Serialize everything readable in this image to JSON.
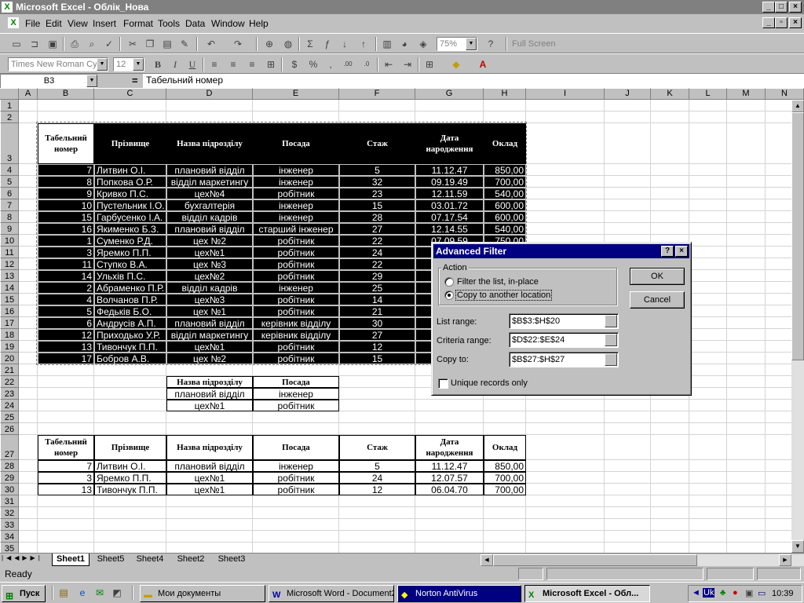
{
  "window": {
    "title": "Microsoft Excel - Облік_Нова"
  },
  "menu": [
    "File",
    "Edit",
    "View",
    "Insert",
    "Format",
    "Tools",
    "Data",
    "Window",
    "Help"
  ],
  "toolbar": {
    "zoom": "75%",
    "fullscreen": "Full Screen",
    "font_name": "Times New Roman Cyr",
    "font_size": "12"
  },
  "formula": {
    "name_box": "B3",
    "eq": "=",
    "content": "Табельний  номер"
  },
  "columns": [
    "A",
    "B",
    "C",
    "D",
    "E",
    "F",
    "G",
    "H",
    "I",
    "J",
    "K",
    "L",
    "M",
    "N"
  ],
  "rows": [
    "1",
    "2",
    "3",
    "4",
    "5",
    "6",
    "7",
    "8",
    "9",
    "10",
    "11",
    "12",
    "13",
    "14",
    "15",
    "16",
    "17",
    "18",
    "19",
    "20",
    "21",
    "22",
    "23",
    "24",
    "25",
    "26",
    "27",
    "28",
    "29",
    "30",
    "31",
    "32",
    "33",
    "34",
    "35"
  ],
  "table_headers": [
    "Табельний номер",
    "Прізвище",
    "Назва підрозділу",
    "Посада",
    "Стаж",
    "Дата народження",
    "Оклад"
  ],
  "main_rows": [
    [
      "7",
      "Литвин О.І.",
      "плановий відділ",
      "інженер",
      "5",
      "11.12.47",
      "850,00"
    ],
    [
      "8",
      "Попкова О.Р.",
      "відділ маркетингу",
      "інженер",
      "32",
      "09.19.49",
      "700,00"
    ],
    [
      "9",
      "Кривко П.С.",
      "цех№4",
      "робітник",
      "23",
      "12.11.59",
      "540,00"
    ],
    [
      "10",
      "Пустельник І.О.",
      "бухгалтерія",
      "інженер",
      "15",
      "03.01.72",
      "600,00"
    ],
    [
      "15",
      "Гарбусенко І.А.",
      "відділ кадрів",
      "інженер",
      "28",
      "07.17.54",
      "600,00"
    ],
    [
      "16",
      "Якименко Б.З.",
      "плановий відділ",
      "старший інженер",
      "27",
      "12.14.55",
      "540,00"
    ],
    [
      "1",
      "Суменко Р.Д.",
      "цех №2",
      "робітник",
      "22",
      "07.09.59",
      "750,00"
    ],
    [
      "3",
      "Яремко П.П.",
      "цех№1",
      "робітник",
      "24",
      "",
      "",
      ""
    ],
    [
      "11",
      "Ступко В.А.",
      "цех №3",
      "робітник",
      "22",
      "",
      ""
    ],
    [
      "14",
      "Ульхів П.С.",
      "цех№2",
      "робітник",
      "29",
      "",
      ""
    ],
    [
      "2",
      "Абраменко П.Р.",
      "відділ кадрів",
      "інженер",
      "25",
      "",
      ""
    ],
    [
      "4",
      "Волчанов П.Р.",
      "цех№3",
      "робітник",
      "14",
      "",
      ""
    ],
    [
      "5",
      "Федьків Б.О.",
      "цех №1",
      "робітник",
      "21",
      "",
      ""
    ],
    [
      "6",
      "Андрусів А.П.",
      "плановий відділ",
      "керівник відділу",
      "30",
      "",
      ""
    ],
    [
      "12",
      "Приходько У.Р.",
      "відділ маркетингу",
      "керівник відділу",
      "27",
      "",
      ""
    ],
    [
      "13",
      "Тивончук П.П.",
      "цех№1",
      "робітник",
      "12",
      "",
      ""
    ],
    [
      "17",
      "Бобров А.В.",
      "цех №2",
      "робітник",
      "15",
      "",
      ""
    ]
  ],
  "criteria": {
    "headers": [
      "Назва підрозділу",
      "Посада"
    ],
    "rows": [
      [
        "плановий відділ",
        "інженер"
      ],
      [
        "цех№1",
        "робітник"
      ]
    ]
  },
  "result_rows": [
    [
      "7",
      "Литвин О.І.",
      "плановий відділ",
      "інженер",
      "5",
      "11.12.47",
      "850,00"
    ],
    [
      "3",
      "Яремко П.П.",
      "цех№1",
      "робітник",
      "24",
      "12.07.57",
      "700,00"
    ],
    [
      "13",
      "Тивончук П.П.",
      "цех№1",
      "робітник",
      "12",
      "06.04.70",
      "700,00"
    ]
  ],
  "sheets": [
    "Sheet1",
    "Sheet5",
    "Sheet4",
    "Sheet2",
    "Sheet3"
  ],
  "status": "Ready",
  "dialog": {
    "title": "Advanced Filter",
    "action_label": "Action",
    "opt1": "Filter the list, in-place",
    "opt2": "Copy to another location",
    "ok": "OK",
    "cancel": "Cancel",
    "list_label": "List range:",
    "list_value": "$B$3:$H$20",
    "criteria_label": "Criteria range:",
    "criteria_value": "$D$22:$E$24",
    "copy_label": "Copy to:",
    "copy_value": "$B$27:$H$27",
    "unique": "Unique records only"
  },
  "taskbar": {
    "start": "Пуск",
    "tasks": [
      "Мои документы",
      "Microsoft Word - Document2",
      "Norton AntiVirus",
      "Microsoft Excel - Обл..."
    ],
    "tray_lang": "Uk",
    "clock": "10:39"
  }
}
